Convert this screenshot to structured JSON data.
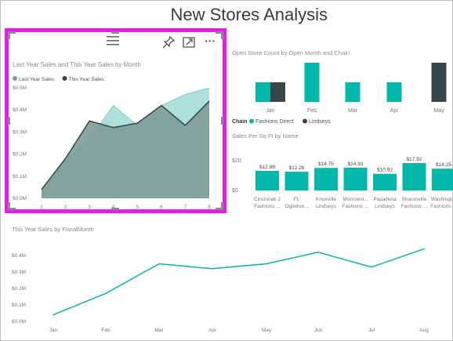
{
  "page": {
    "title": "New Stores Analysis"
  },
  "colors": {
    "teal": "#01b8aa",
    "dark": "#374649",
    "area_fill": "#7f9b97",
    "area_fill2": "#9fdad4",
    "highlight": "#e81ce8",
    "axis_text": "#777777"
  },
  "focus_tile": {
    "toolbar": {
      "drag_icon": "hamburger-icon",
      "pin_icon": "pin-icon",
      "focus_icon": "focus-mode-icon",
      "more_icon": "ellipsis-icon",
      "more_label": "···"
    }
  },
  "chart_data": [
    {
      "type": "area",
      "title": "Last Year Sales and This Year Sales by Month",
      "legend_position": "top-left",
      "categories": [
        "1",
        "2",
        "3",
        "4",
        "5",
        "6",
        "7",
        "8"
      ],
      "y_ticks": [
        "$0.0M",
        "$0.1M",
        "$0.2M",
        "$0.3M",
        "$0.4M",
        "$0.5M"
      ],
      "ylim": [
        0,
        0.5
      ],
      "series": [
        {
          "name": "Last Year Sales",
          "values": [
            0.04,
            0.17,
            0.27,
            0.42,
            0.33,
            0.42,
            0.47,
            0.5
          ]
        },
        {
          "name": "This Year Sales",
          "values": [
            0.04,
            0.18,
            0.35,
            0.32,
            0.34,
            0.42,
            0.33,
            0.44
          ]
        }
      ]
    },
    {
      "type": "bar",
      "title": "Open Store Count by Open Month and Chain",
      "legend_title": "Chain",
      "legend_position": "bottom-left",
      "categories": [
        "Jan",
        "Feb",
        "Mar",
        "Apr",
        "May"
      ],
      "series": [
        {
          "name": "Fashions Direct",
          "values": [
            1,
            2,
            1,
            1,
            0
          ]
        },
        {
          "name": "Lindseys",
          "values": [
            1,
            0,
            0,
            0,
            2
          ]
        }
      ],
      "ylim": [
        0,
        2
      ]
    },
    {
      "type": "bar",
      "title": "Sales Per Sq Ft by Name",
      "y_ticks": [
        "$0",
        "$20"
      ],
      "ylim": [
        0,
        25
      ],
      "categories": [
        "Cincinnati 2 Fashions ...",
        "Ft. Oglethor...",
        "Knoxville Lindseys",
        "Monroevi... Fashions ...",
        "Pasadena Lindseys",
        "Sharonville Fashions ...",
        "Washingt... Fashions ..."
      ],
      "values": [
        12.86,
        12.26,
        14.75,
        14.93,
        10.92,
        17.92,
        14.25
      ],
      "data_labels": [
        "$12.86",
        "$12.26",
        "$14.75",
        "$14.93",
        "$10.92",
        "$17.92",
        "$14.25"
      ]
    },
    {
      "type": "line",
      "title": "This Year Sales by FiscalMonth",
      "categories": [
        "Jan",
        "Feb",
        "Mar",
        "Apr",
        "May",
        "Jun",
        "Jul",
        "Aug"
      ],
      "values": [
        0.04,
        0.17,
        0.35,
        0.32,
        0.35,
        0.42,
        0.33,
        0.44
      ],
      "y_ticks": [
        "$0.0M",
        "$0.1M",
        "$0.2M",
        "$0.3M",
        "$0.4M"
      ],
      "ylim": [
        0,
        0.4
      ]
    }
  ]
}
